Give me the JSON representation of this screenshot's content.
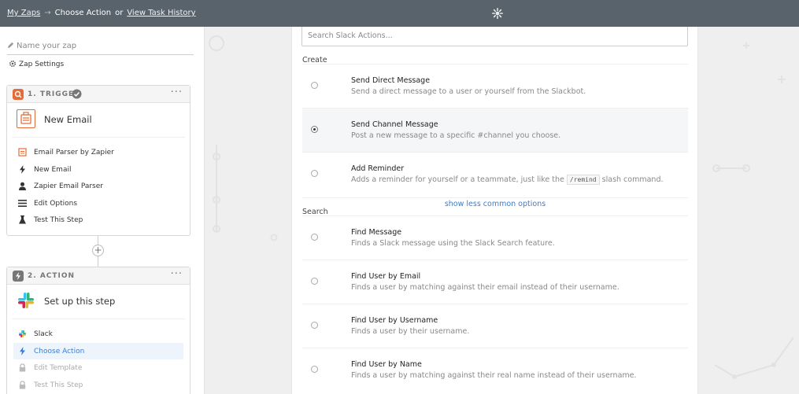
{
  "header": {
    "my_zaps": "My Zaps",
    "arrow": "→",
    "current": "Choose Action",
    "or": "or",
    "task_history": "View Task History"
  },
  "sidebar": {
    "zap_name_placeholder": "Name your zap",
    "zap_settings": "Zap Settings",
    "trigger": {
      "label": "1. TRIGGER",
      "menu": "···",
      "title": "New Email",
      "items": [
        {
          "label": "Email Parser by Zapier",
          "icon": "email-parser-icon"
        },
        {
          "label": "New Email",
          "icon": "bolt-icon"
        },
        {
          "label": "Zapier Email Parser",
          "icon": "user-icon"
        },
        {
          "label": "Edit Options",
          "icon": "list-icon"
        },
        {
          "label": "Test This Step",
          "icon": "flask-icon"
        }
      ]
    },
    "plus": "+",
    "action": {
      "label": "2. ACTION",
      "menu": "···",
      "title": "Set up this step",
      "items": [
        {
          "label": "Slack",
          "icon": "slack-icon"
        },
        {
          "label": "Choose Action",
          "icon": "bolt-icon"
        },
        {
          "label": "Edit Template",
          "icon": "lock-icon"
        },
        {
          "label": "Test This Step",
          "icon": "lock-icon"
        }
      ]
    }
  },
  "main": {
    "search_placeholder": "Search Slack Actions...",
    "create_label": "Create",
    "search_label": "Search",
    "show_less": "show less common options",
    "create_options": [
      {
        "title": "Send Direct Message",
        "desc": "Send a direct message to a user or yourself from the Slackbot."
      },
      {
        "title": "Send Channel Message",
        "desc": "Post a new message to a specific #channel you choose.",
        "selected": true
      },
      {
        "title": "Add Reminder",
        "desc_before": "Adds a reminder for yourself or a teammate, just like the",
        "code": "/remind",
        "desc_after": "slash command."
      }
    ],
    "search_options": [
      {
        "title": "Find Message",
        "desc": "Finds a Slack message using the Slack Search feature."
      },
      {
        "title": "Find User by Email",
        "desc": "Finds a user by matching against their email instead of their username."
      },
      {
        "title": "Find User by Username",
        "desc": "Finds a user by their username."
      },
      {
        "title": "Find User by Name",
        "desc": "Finds a user by matching against their real name instead of their username."
      }
    ]
  },
  "colors": {
    "topbar": "#59636b",
    "accent": "#3b7dd0",
    "trigger_orange": "#e36d3a"
  }
}
